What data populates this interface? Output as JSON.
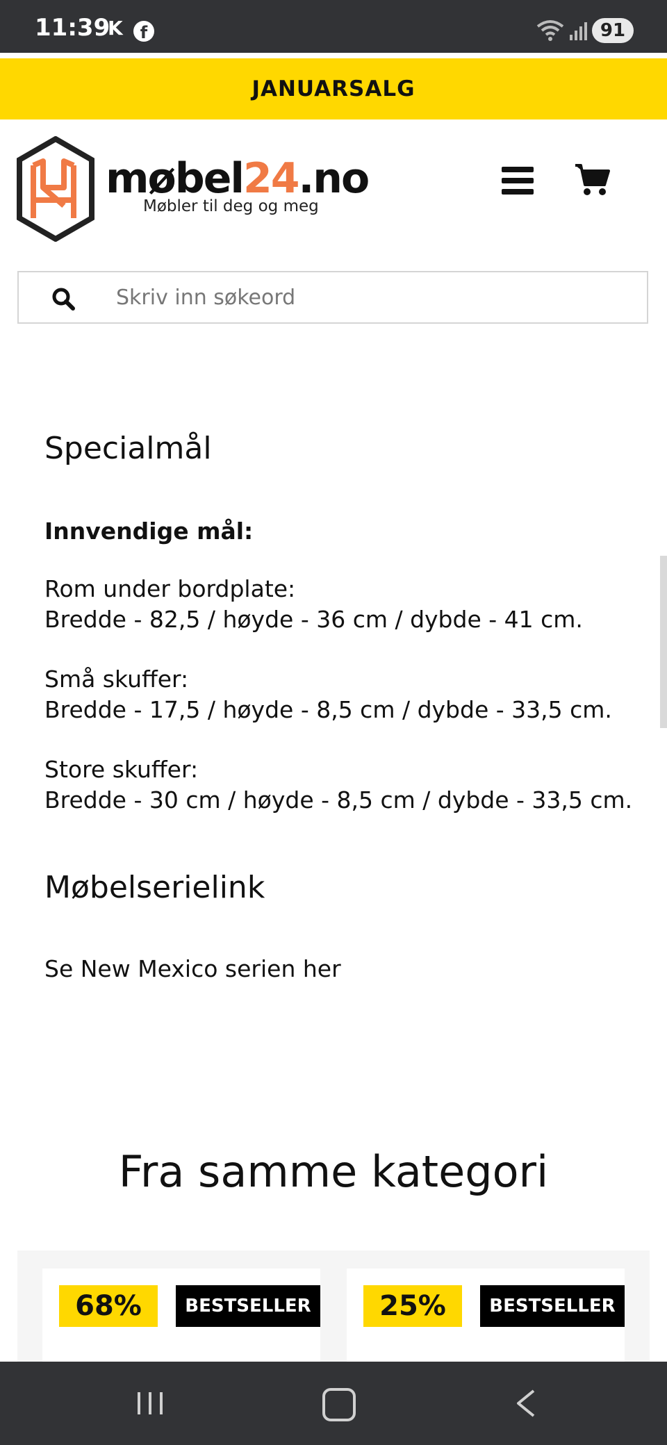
{
  "status_bar": {
    "time": "11:39",
    "carrier_badge": "K",
    "app_icon": "facebook-icon",
    "battery": "91",
    "icons": [
      "wifi-icon",
      "signal-icon"
    ]
  },
  "promo": {
    "text": "JANUARSALG",
    "color": "#ffd800"
  },
  "header": {
    "brand_name": "møbel",
    "brand_accent": "24",
    "brand_suffix": ".no",
    "tagline": "Møbler til deg og meg",
    "accent_color": "#f07a45",
    "icons": [
      "menu-icon",
      "cart-icon"
    ]
  },
  "search": {
    "placeholder": "Skriv inn søkeord"
  },
  "specs": {
    "title": "Specialmål",
    "subheading": "Innvendige mål:",
    "blocks": [
      {
        "label": "Rom under bordplate:",
        "value": "Bredde - 82,5 / høyde - 36 cm / dybde - 41 cm."
      },
      {
        "label": "Små skuffer:",
        "value": "Bredde - 17,5 / høyde - 8,5 cm / dybde - 33,5 cm."
      },
      {
        "label": "Store skuffer:",
        "value": "Bredde - 30 cm / høyde - 8,5 cm / dybde - 33,5 cm."
      }
    ]
  },
  "series": {
    "title": "Møbelserielink",
    "link_text": "Se New Mexico serien her"
  },
  "category": {
    "title": "Fra samme kategori",
    "products": [
      {
        "discount": "68%",
        "badge": "BESTSELLER"
      },
      {
        "discount": "25%",
        "badge": "BESTSELLER"
      }
    ]
  },
  "nav": {
    "icons": [
      "recents-icon",
      "home-icon",
      "back-icon"
    ]
  }
}
